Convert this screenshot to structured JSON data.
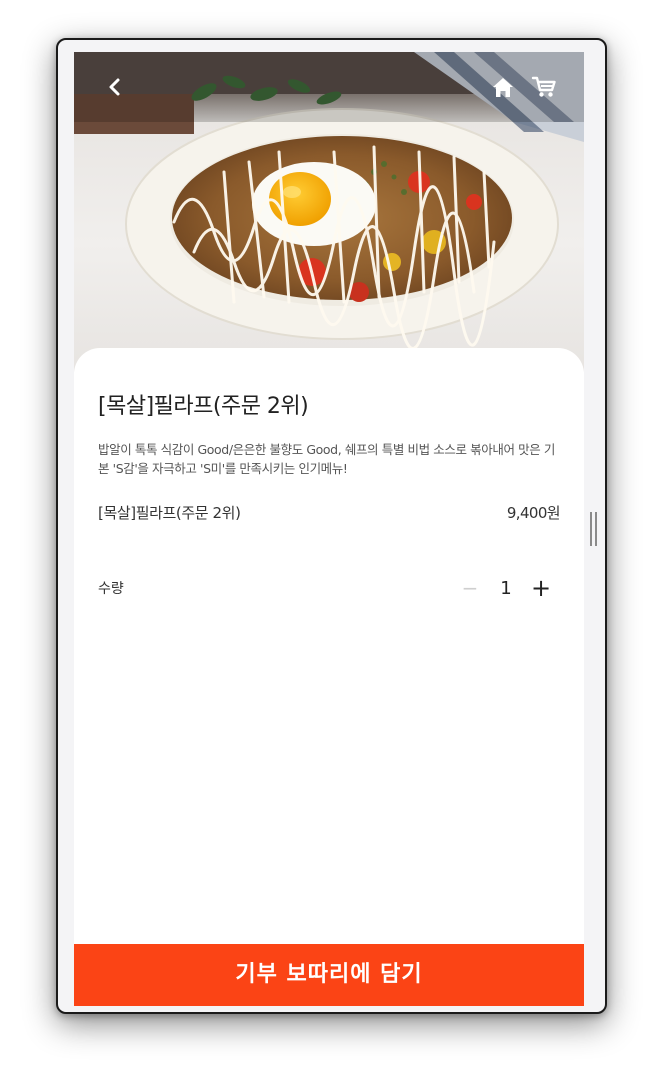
{
  "header": {
    "back_icon": "chevron-left-icon",
    "home_icon": "home-icon",
    "cart_icon": "cart-icon"
  },
  "product": {
    "title": "[목살]필라프(주문 2위)",
    "description": "밥알이 톡톡 식감이 Good/은은한 불향도 Good, 쉐프의 특별 비법 소스로 볶아내어 맛은 기본 'S감'을 자극하고 'S미'를 만족시키는 인기메뉴!",
    "option_name": "[목살]필라프(주문 2위)",
    "option_price": "9,400원"
  },
  "quantity": {
    "label": "수량",
    "minus": "−",
    "value": "1",
    "plus": "+"
  },
  "cta": {
    "label": "기부 보따리에 담기"
  },
  "colors": {
    "accent": "#fb4415",
    "text": "#222222",
    "muted": "#555555"
  }
}
